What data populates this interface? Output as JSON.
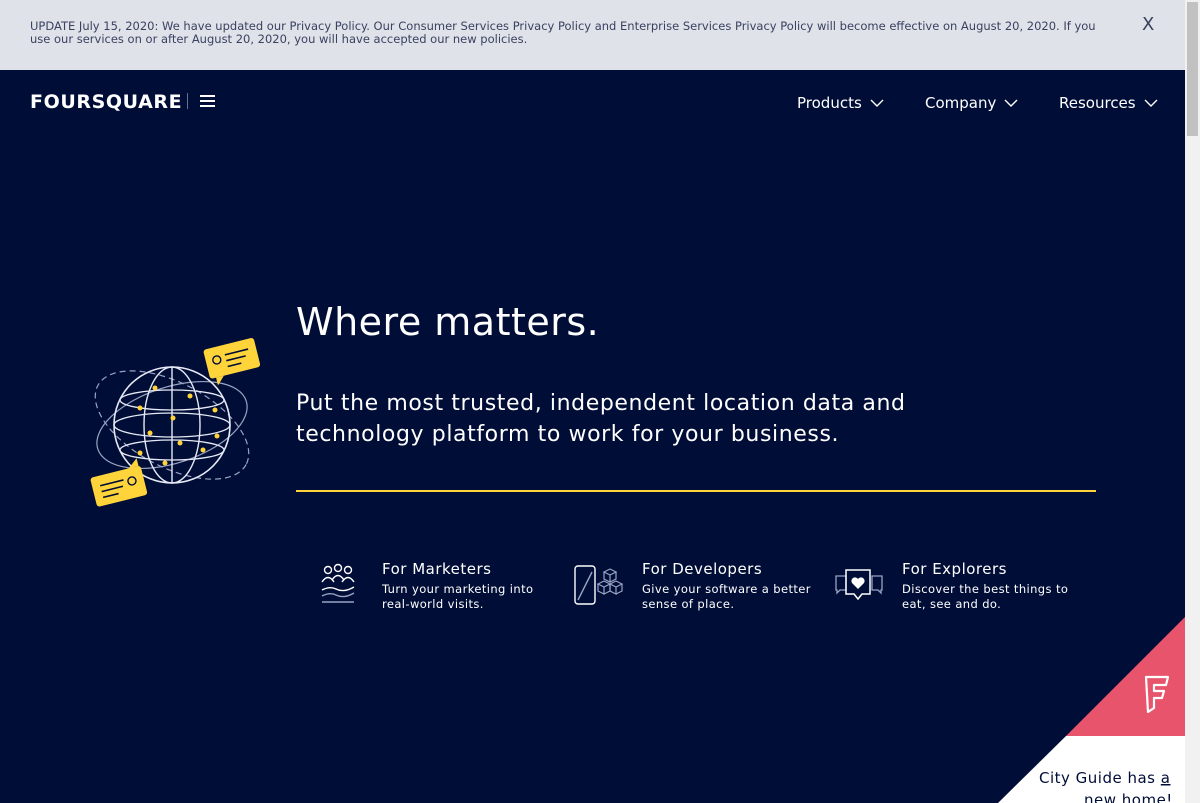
{
  "banner": {
    "text": "UPDATE July 15, 2020: We have updated our Privacy Policy. Our Consumer Services Privacy Policy and Enterprise Services Privacy Policy will become effective on August 20, 2020. If you use our services on or after August 20, 2020, you will have accepted our new policies.",
    "close_label": "X"
  },
  "header": {
    "logo": "FOURSQUARE",
    "nav": [
      {
        "label": "Products",
        "icon": "chevron-down-icon"
      },
      {
        "label": "Company",
        "icon": "chevron-down-icon"
      },
      {
        "label": "Resources",
        "icon": "chevron-down-icon"
      }
    ]
  },
  "hero": {
    "title": "Where matters.",
    "subtitle": "Put the most trusted, independent location data and technology platform to work for your business."
  },
  "features": [
    {
      "title": "For Marketers",
      "desc": "Turn your marketing into real-world visits.",
      "icon": "people-icon"
    },
    {
      "title": "For Developers",
      "desc": "Give your software a better sense of place.",
      "icon": "phone-cubes-icon"
    },
    {
      "title": "For Explorers",
      "desc": "Discover the best things to eat, see and do.",
      "icon": "heart-chat-icon"
    }
  ],
  "city_guide": {
    "text_before": "City Guide has ",
    "link_a": "a",
    "link_rest": "new home!"
  },
  "colors": {
    "background": "#000d36",
    "banner": "#dfe2e9",
    "accent_yellow": "#ffd43b",
    "accent_pink": "#e8546b"
  }
}
